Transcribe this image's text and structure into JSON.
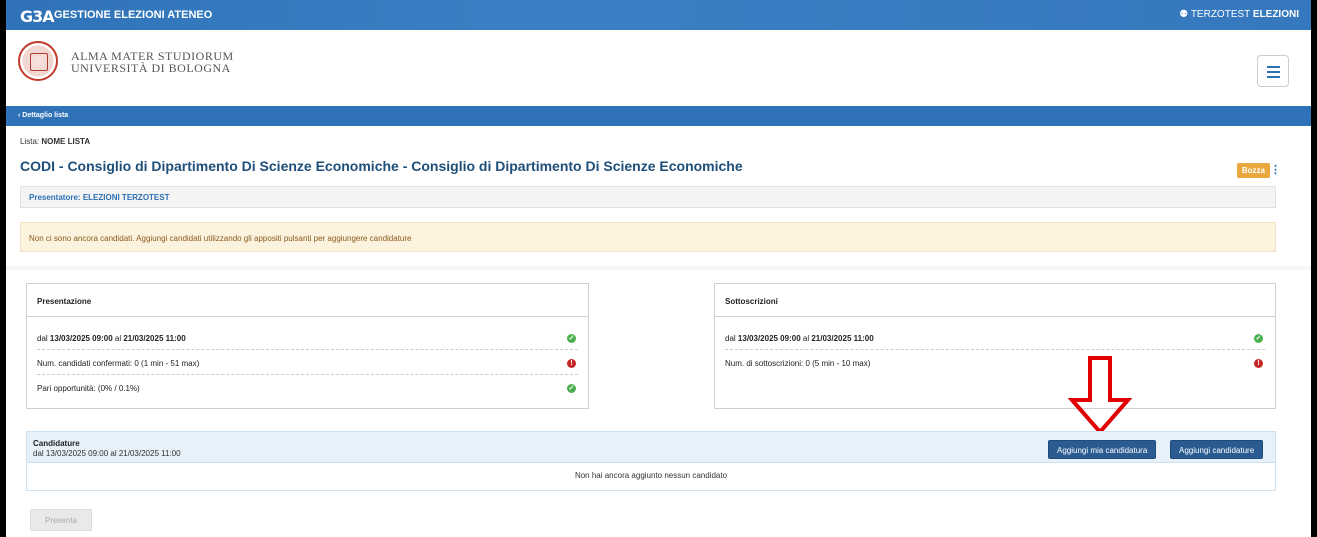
{
  "topbar": {
    "logo": "G3A",
    "app_title": "GESTIONE ELEZIONI ATENEO",
    "user_first": "TERZOTEST",
    "user_last": "ELEZIONI"
  },
  "header": {
    "university_line1": "ALMA MATER STUDIORUM",
    "university_line2": "UNIVERSITÀ DI BOLOGNA"
  },
  "subbar": {
    "back_label": "Dettaglio lista"
  },
  "lista": {
    "label": "Lista:",
    "name": "NOME LISTA"
  },
  "title": "CODI - Consiglio di Dipartimento Di Scienze Economiche - Consiglio di Dipartimento Di Scienze Economiche",
  "status_badge": "Bozza",
  "presentatore": {
    "label": "Presentatore:",
    "name": "ELEZIONI TERZOTEST"
  },
  "alert": "Non ci sono ancora candidati. Aggiungi candidati utilizzando gli appositi pulsanti per aggiungere candidature",
  "presentazione": {
    "title": "Presentazione",
    "period_prefix": "dal",
    "period_from": "13/03/2025 09:00",
    "period_mid": "al",
    "period_to": "21/03/2025 11:00",
    "candidati": "Num. candidati confermati: 0 (1 min - 51 max)",
    "pari": "Pari opportunità: (0% / 0.1%)"
  },
  "sottoscrizioni": {
    "title": "Sottoscrizioni",
    "period_prefix": "dal",
    "period_from": "13/03/2025 09:00",
    "period_mid": "al",
    "period_to": "21/03/2025 11:00",
    "count": "Num. di sottoscrizioni: 0 (5 min - 10 max)"
  },
  "candidature": {
    "title": "Candidature",
    "period": "dal 13/03/2025 09:00 al 21/03/2025 11:00",
    "btn_mia": "Aggiungi mia candidatura",
    "btn_add": "Aggiungi candidature",
    "empty": "Non hai ancora aggiunto nessun candidato"
  },
  "presenta_button": "Presenta",
  "colors": {
    "brand": "#2f72b8",
    "ok": "#4caf50",
    "error": "#c62828",
    "arrow": "#e00000",
    "badge": "#e8a83e"
  }
}
